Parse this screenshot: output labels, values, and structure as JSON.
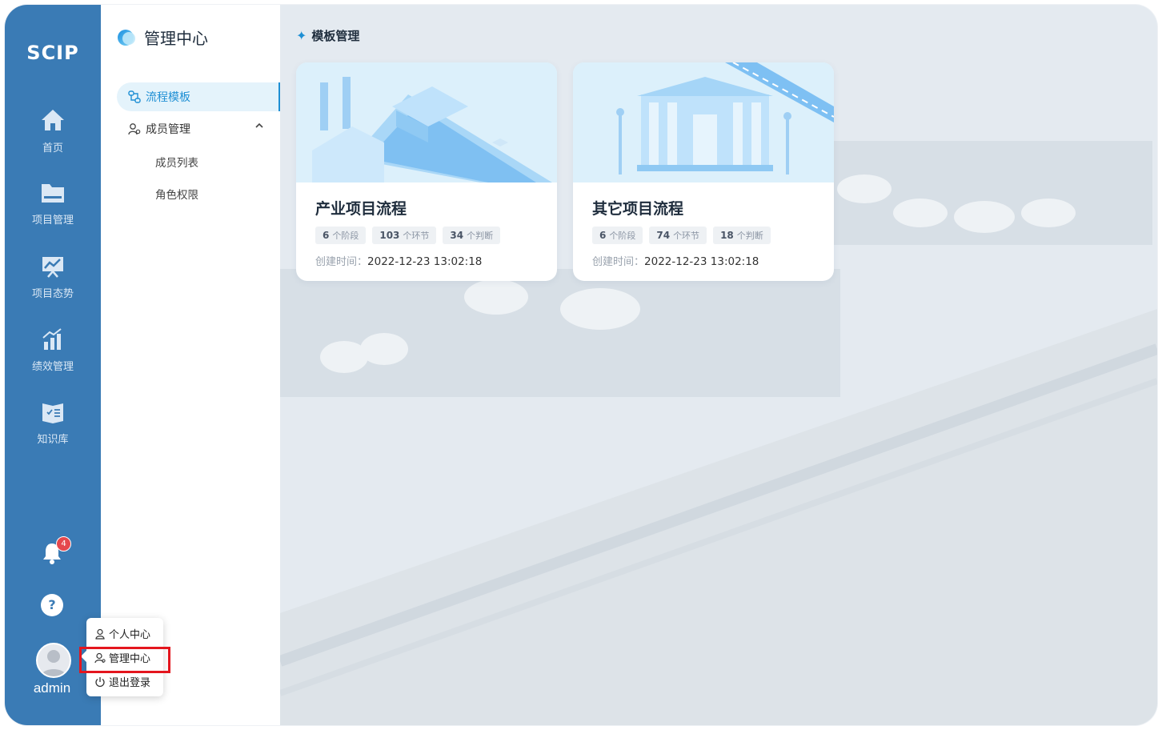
{
  "rail": {
    "logo": "SCIP",
    "items": [
      {
        "label": "首页",
        "icon": "home-icon"
      },
      {
        "label": "项目管理",
        "icon": "folder-icon"
      },
      {
        "label": "项目态势",
        "icon": "trend-board-icon"
      },
      {
        "label": "绩效管理",
        "icon": "bar-chart-icon"
      },
      {
        "label": "知识库",
        "icon": "book-icon"
      }
    ],
    "notification_count": "4",
    "help_glyph": "?",
    "user_name": "admin"
  },
  "subnav": {
    "title": "管理中心",
    "active_item": "流程模板",
    "group": "成员管理",
    "group_items": [
      "成员列表",
      "角色权限"
    ]
  },
  "main": {
    "title": "模板管理",
    "cards": [
      {
        "name": "产业项目流程",
        "stages": "6",
        "stages_unit": "个阶段",
        "steps": "103",
        "steps_unit": "个环节",
        "judgments": "34",
        "judgments_unit": "个判断",
        "created_label": "创建时间：",
        "created_value": "2022-12-23 13:02:18"
      },
      {
        "name": "其它项目流程",
        "stages": "6",
        "stages_unit": "个阶段",
        "steps": "74",
        "steps_unit": "个环节",
        "judgments": "18",
        "judgments_unit": "个判断",
        "created_label": "创建时间：",
        "created_value": "2022-12-23 13:02:18"
      }
    ]
  },
  "user_menu": {
    "items": [
      "个人中心",
      "管理中心",
      "退出登录"
    ],
    "highlighted": "管理中心"
  },
  "colors": {
    "rail": "#3a7bb5",
    "accent": "#1e8fd4",
    "badge": "#e5484d",
    "highlight_box": "#e4161e"
  }
}
